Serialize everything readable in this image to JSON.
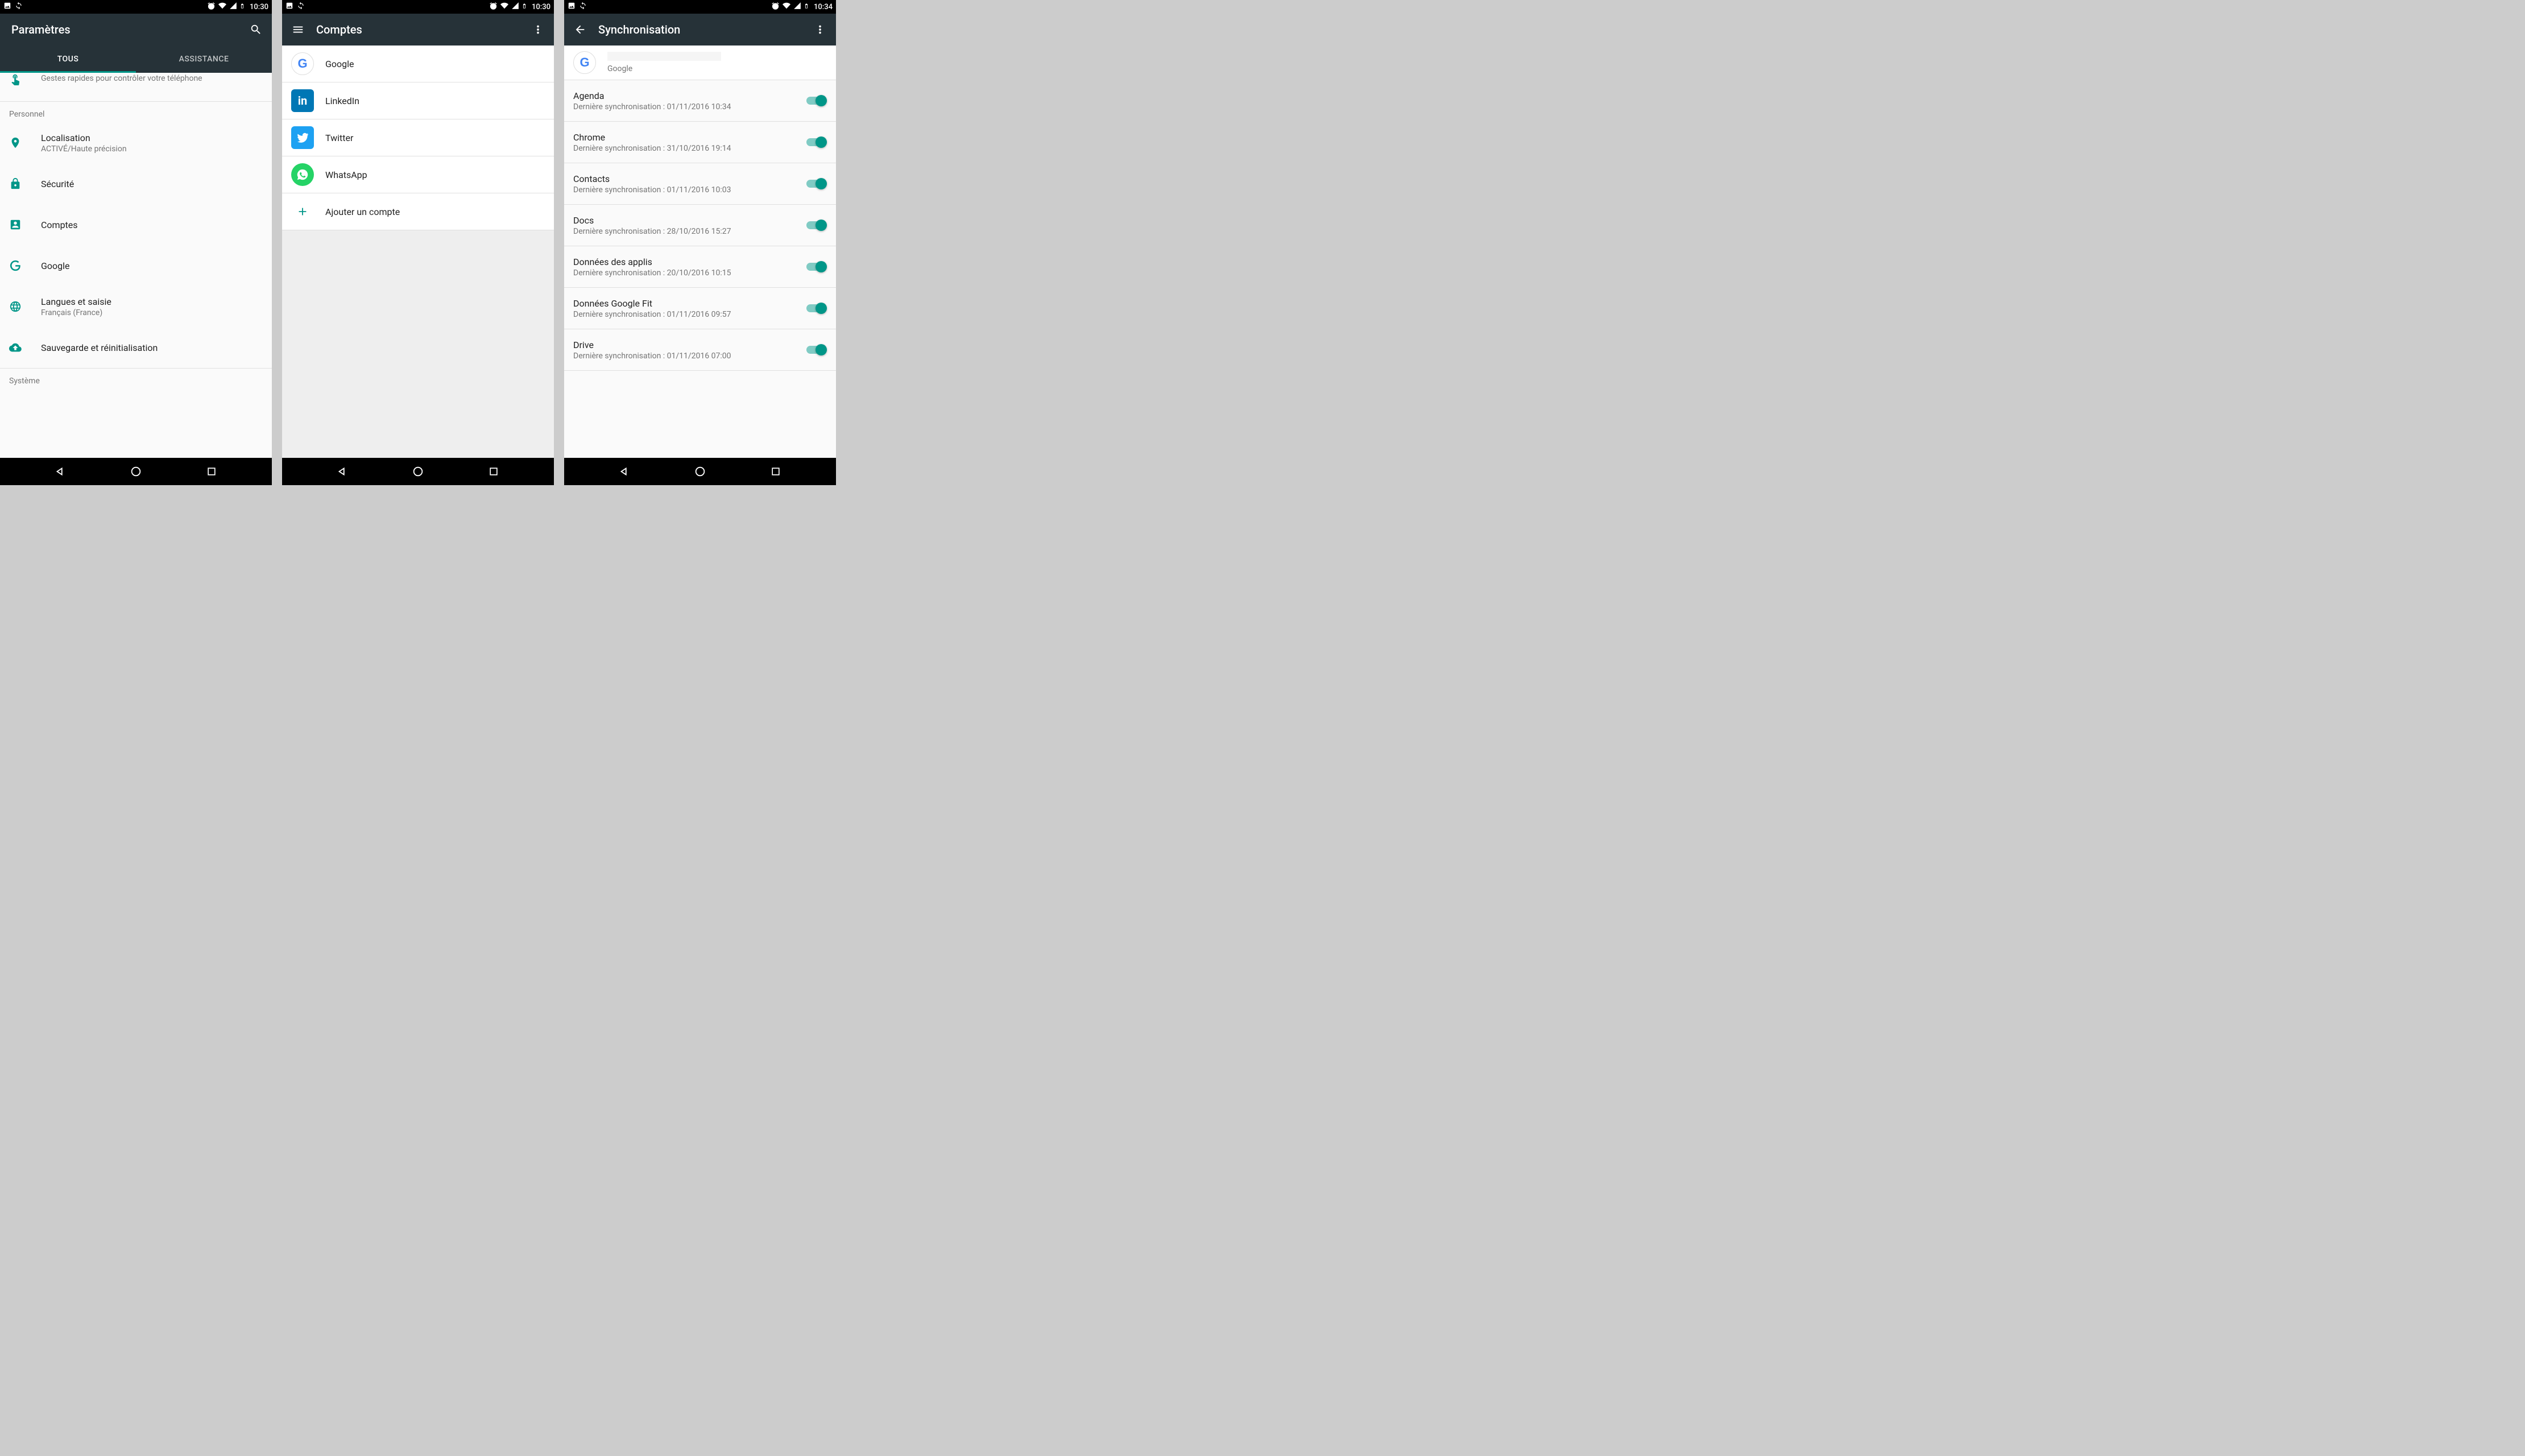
{
  "screens": {
    "settings": {
      "status_time": "10:30",
      "title": "Paramètres",
      "tabs": {
        "all": "TOUS",
        "assist": "ASSISTANCE"
      },
      "truncated_item": {
        "sub": "Gestes rapides pour contrôler votre téléphone"
      },
      "section_personal": "Personnel",
      "items": {
        "location": {
          "title": "Localisation",
          "sub": "ACTIVÉ/Haute précision"
        },
        "security": {
          "title": "Sécurité"
        },
        "accounts": {
          "title": "Comptes"
        },
        "google": {
          "title": "Google"
        },
        "languages": {
          "title": "Langues et saisie",
          "sub": "Français (France)"
        },
        "backup": {
          "title": "Sauvegarde et réinitialisation"
        }
      },
      "section_system": "Système"
    },
    "accounts": {
      "status_time": "10:30",
      "title": "Comptes",
      "items": {
        "google": "Google",
        "linkedin": "LinkedIn",
        "twitter": "Twitter",
        "whatsapp": "WhatsApp",
        "add": "Ajouter un compte"
      }
    },
    "sync": {
      "status_time": "10:34",
      "title": "Synchronisation",
      "account_provider": "Google",
      "items": [
        {
          "title": "Agenda",
          "sub": "Dernière synchronisation : 01/11/2016 10:34",
          "on": true
        },
        {
          "title": "Chrome",
          "sub": "Dernière synchronisation : 31/10/2016 19:14",
          "on": true
        },
        {
          "title": "Contacts",
          "sub": "Dernière synchronisation : 01/11/2016 10:03",
          "on": true
        },
        {
          "title": "Docs",
          "sub": "Dernière synchronisation : 28/10/2016 15:27",
          "on": true
        },
        {
          "title": "Données des applis",
          "sub": "Dernière synchronisation : 20/10/2016 10:15",
          "on": true
        },
        {
          "title": "Données Google Fit",
          "sub": "Dernière synchronisation : 01/11/2016 09:57",
          "on": true
        },
        {
          "title": "Drive",
          "sub": "Dernière synchronisation : 01/11/2016 07:00",
          "on": true
        }
      ]
    }
  }
}
